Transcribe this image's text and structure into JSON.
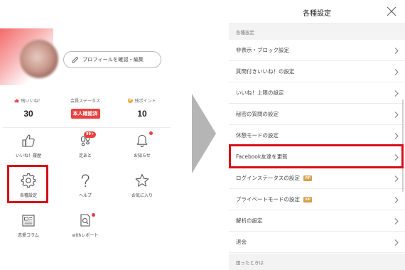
{
  "left": {
    "profile_button_label": "プロフィールを確認・編集",
    "stats": {
      "likes": {
        "label": "残いいね！",
        "value": "30"
      },
      "member_status": {
        "label": "会員ステータス",
        "badge": "本人確認済"
      },
      "points": {
        "label": "残ポイント",
        "coin": "P",
        "value": "10"
      }
    },
    "menu": {
      "likes_history": "いいね！履歴",
      "footprints": "足あと",
      "footprints_badge": "99+",
      "notifications": "お知らせ",
      "settings": "各種設定",
      "help": "ヘルプ",
      "favorites": "お気に入り",
      "column": "恋愛コラム",
      "with_report": "withレポート"
    }
  },
  "right": {
    "title": "各種設定",
    "section_header": "各種設定",
    "items": [
      {
        "label": "非表示・ブロック設定"
      },
      {
        "label": "質問付きいいね！の設定"
      },
      {
        "label": "いいね！上限の設定"
      },
      {
        "label": "秘密の質問の設定"
      },
      {
        "label": "休憩モードの設定"
      },
      {
        "label": "Facebook友達を更新"
      },
      {
        "label": "ログインステータスの設定",
        "vip": "VIP"
      },
      {
        "label": "プライベートモードの設定",
        "vip": "VIP"
      },
      {
        "label": "解析の設定"
      },
      {
        "label": "退会"
      }
    ],
    "footer_section": "困ったときは"
  },
  "colors": {
    "accent_red": "#d80f16",
    "badge_red": "#e94040",
    "vip_gold": "#d6a04c",
    "arrow_gray": "#b5b5b5"
  }
}
